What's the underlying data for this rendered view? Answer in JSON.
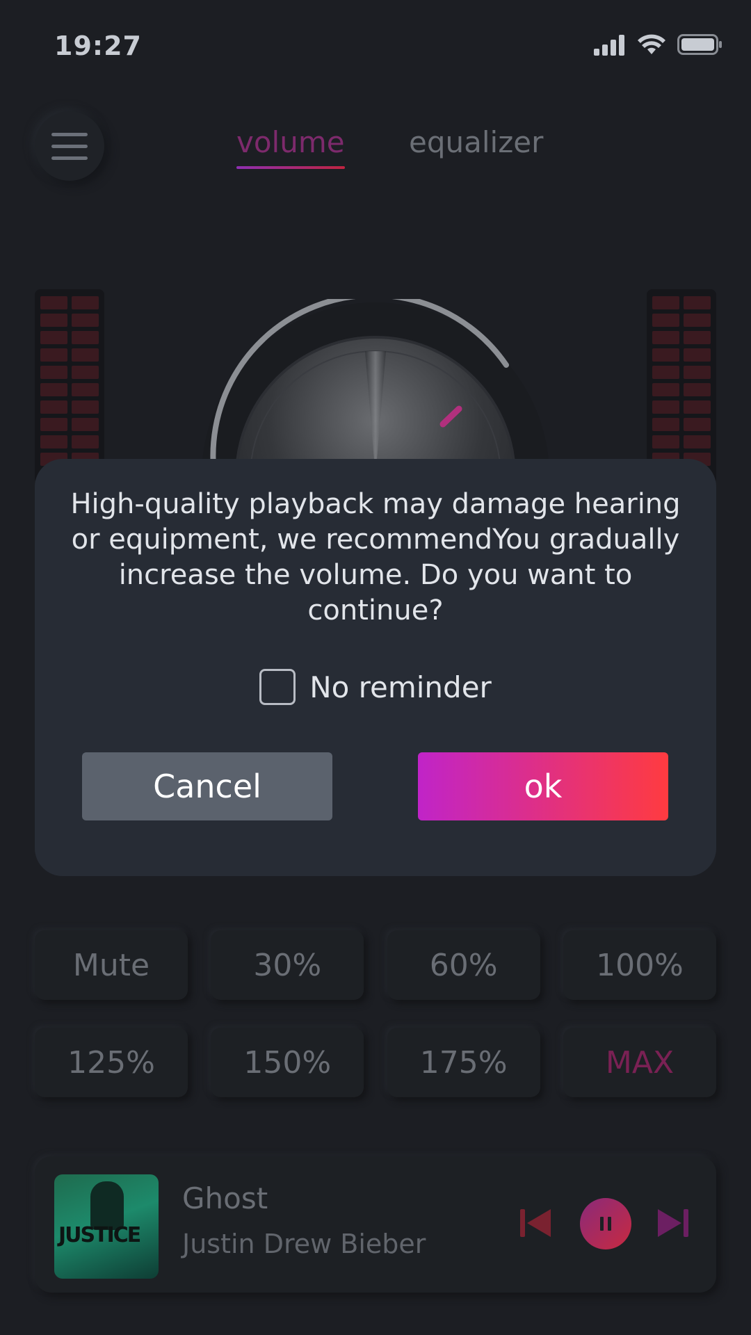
{
  "status_bar": {
    "time": "19:27",
    "icons": [
      "signal-icon",
      "wifi-icon",
      "battery-icon"
    ]
  },
  "header": {
    "menu_icon": "menu-icon",
    "tabs": [
      {
        "label": "volume",
        "active": true
      },
      {
        "label": "equalizer",
        "active": false
      }
    ]
  },
  "knob": {
    "ring_color": "#8c8f94",
    "indicator_color": "#b1307d"
  },
  "presets": {
    "row1": [
      "Mute",
      "30%",
      "60%",
      "100%"
    ],
    "row2": [
      "125%",
      "150%",
      "175%",
      "MAX"
    ]
  },
  "player": {
    "title": "Ghost",
    "artist": "Justin Drew Bieber",
    "album_art_text": "JUSTICE",
    "controls": [
      "previous-icon",
      "pause-icon",
      "next-icon"
    ]
  },
  "dialog": {
    "message": "High-quality playback may damage hearing or equipment, we recommendYou gradually increase the volume. Do you want to continue?",
    "checkbox_label": "No reminder",
    "checkbox_checked": false,
    "cancel_label": "Cancel",
    "ok_label": "ok"
  },
  "colors": {
    "background": "#1c1e23",
    "dialog": "#272c35",
    "accent_start": "#c024c8",
    "accent_end": "#ff3b40",
    "cancel_button": "#5b626d"
  }
}
